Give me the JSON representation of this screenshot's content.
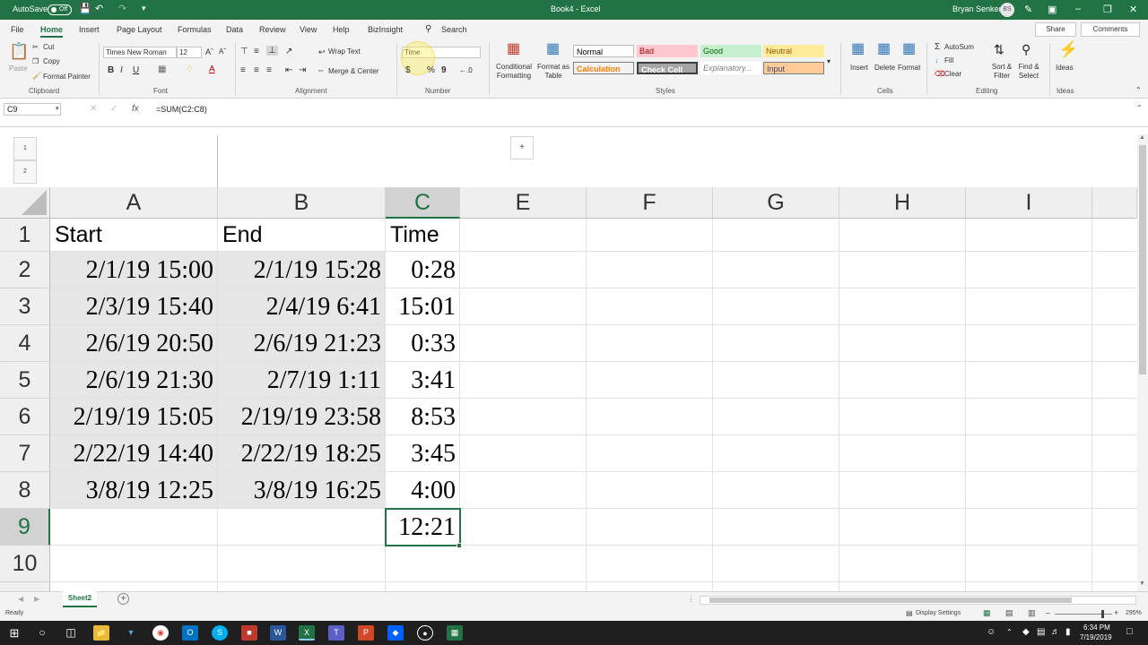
{
  "titlebar": {
    "autosave_label": "AutoSave",
    "autosave_state": "Off",
    "doc_title": "Book4 - Excel",
    "user_name": "Bryan Senker",
    "user_initials": "BS"
  },
  "menu": {
    "tabs": [
      "File",
      "Home",
      "Insert",
      "Page Layout",
      "Formulas",
      "Data",
      "Review",
      "View",
      "Help",
      "BizInsight"
    ],
    "search": "Search",
    "share": "Share",
    "comments": "Comments"
  },
  "ribbon": {
    "clipboard": {
      "paste": "Paste",
      "cut": "Cut",
      "copy": "Copy",
      "format_painter": "Format Painter",
      "group": "Clipboard"
    },
    "font": {
      "name": "Times New Roman",
      "size": "12",
      "group": "Font"
    },
    "alignment": {
      "wrap": "Wrap Text",
      "merge": "Merge & Center",
      "group": "Alignment"
    },
    "number": {
      "format": "Time",
      "currency": "$",
      "percent": "%",
      "comma": "9",
      "group": "Number"
    },
    "styles": {
      "conditional": "Conditional\nFormatting",
      "format_table": "Format as\nTable",
      "cells": [
        "Normal",
        "Bad",
        "Good",
        "Neutral",
        "Calculation",
        "Check Cell",
        "Explanatory...",
        "Input"
      ],
      "group": "Styles"
    },
    "cells": {
      "insert": "Insert",
      "delete": "Delete",
      "format": "Format",
      "group": "Cells"
    },
    "editing": {
      "autosum": "AutoSum",
      "fill": "Fill",
      "clear": "Clear",
      "sort": "Sort &\nFilter",
      "find": "Find &\nSelect",
      "group": "Editing"
    },
    "ideas": {
      "label": "Ideas",
      "group": "Ideas"
    }
  },
  "formula_bar": {
    "name_box": "C9",
    "formula": "=SUM(C2:C8)"
  },
  "outline": {
    "levels": [
      "1",
      "2"
    ],
    "expand": "+"
  },
  "sheet": {
    "columns": [
      "A",
      "B",
      "C",
      "E",
      "F",
      "G",
      "H",
      "I"
    ],
    "rows": [
      "1",
      "2",
      "3",
      "4",
      "5",
      "6",
      "7",
      "8",
      "9",
      "10"
    ],
    "headers": [
      "Start",
      "End",
      "Time"
    ],
    "data": [
      [
        "2/1/19 15:00",
        "2/1/19 15:28",
        "0:28"
      ],
      [
        "2/3/19 15:40",
        "2/4/19 6:41",
        "15:01"
      ],
      [
        "2/6/19 20:50",
        "2/6/19 21:23",
        "0:33"
      ],
      [
        "2/6/19 21:30",
        "2/7/19 1:11",
        "3:41"
      ],
      [
        "2/19/19 15:05",
        "2/19/19 23:58",
        "8:53"
      ],
      [
        "2/22/19 14:40",
        "2/22/19 18:25",
        "3:45"
      ],
      [
        "3/8/19 12:25",
        "3/8/19 16:25",
        "4:00"
      ]
    ],
    "total": "12:21"
  },
  "sheet_tabs": {
    "active": "Sheet2",
    "add": "+"
  },
  "status": {
    "left": "Ready",
    "display_settings": "Display Settings",
    "zoom": "295%"
  },
  "taskbar": {
    "time": "6:34 PM",
    "date": "7/19/2019"
  }
}
